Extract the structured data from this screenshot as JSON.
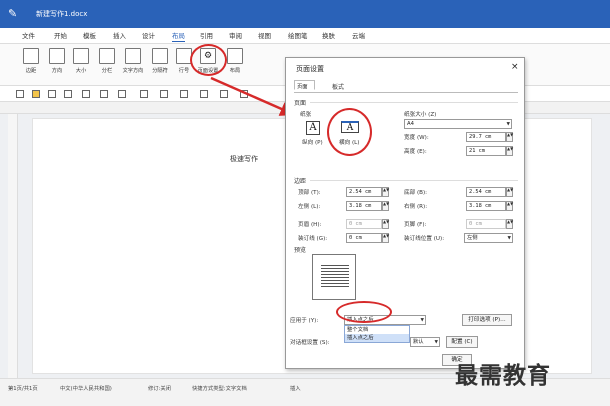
{
  "window": {
    "title": "新建写作1.docx"
  },
  "menu": [
    "文件",
    "开始",
    "模板",
    "插入",
    "设计",
    "布局",
    "引用",
    "审阅",
    "视图",
    "绘图笔",
    "换肤",
    "云端"
  ],
  "ribbon": [
    "边距",
    "方向",
    "大小",
    "分栏",
    "文字方向",
    "分隔符",
    "行号",
    "页面设置",
    "布局"
  ],
  "document": {
    "text": "极速写作"
  },
  "status": [
    "第1页/共1页",
    "中文(中华人民共和国)",
    "修订:关闭",
    "快捷方式类型:文字文档",
    "插入"
  ],
  "dialog": {
    "title": "页面设置",
    "close": "×",
    "tabs": [
      "页面",
      "板式"
    ],
    "page_label": "页面",
    "orientation": {
      "label": "纸张",
      "portrait": "纵向 (P)",
      "landscape": "横向 (L)"
    },
    "paper": {
      "size_label": "纸张大小 (Z)",
      "size_value": "A4",
      "width_label": "宽度 (W):",
      "width_value": "29.7 cm",
      "height_label": "高度 (E):",
      "height_value": "21 cm"
    },
    "margins": {
      "section_label": "边距",
      "top_label": "顶部 (T):",
      "top_value": "2.54 cm",
      "bottom_label": "底部 (B):",
      "bottom_value": "2.54 cm",
      "left_label": "左侧 (L):",
      "left_value": "3.18 cm",
      "right_label": "右侧 (R):",
      "right_value": "3.18 cm",
      "header_label": "页眉 (H):",
      "header_value": "0 cm",
      "footer_label": "页脚 (F):",
      "footer_value": "0 cm",
      "gutter_label": "装订线 (G):",
      "gutter_value": "0 cm",
      "gutter_pos_label": "装订线位置 (U):",
      "gutter_pos_value": "左侧"
    },
    "preview_label": "预览",
    "apply": {
      "label": "应用于 (Y):",
      "value": "插入点之后",
      "options": [
        "整个文档",
        "插入点之后"
      ],
      "print_options": "打印选项 (P)…"
    },
    "dialog_setting": {
      "label": "对话框设置 (S):",
      "value": "默认",
      "config": "配置 (C)"
    },
    "ok": "确定"
  },
  "watermark": "最需教育",
  "colors": {
    "accent": "#2a62b8",
    "annotation": "#d62a2a"
  }
}
